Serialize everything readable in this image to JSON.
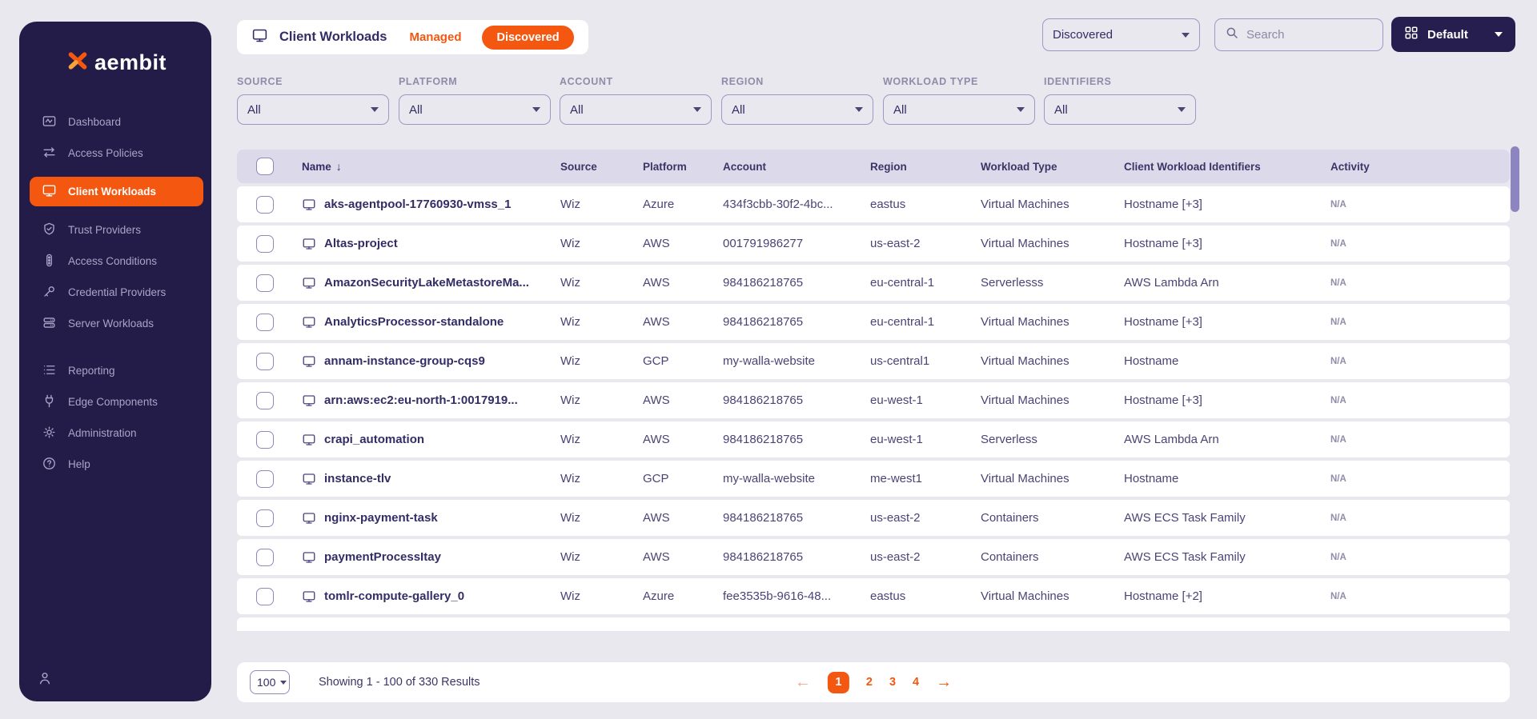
{
  "brand": {
    "logo_text": "aembit"
  },
  "colors": {
    "accent_orange": "#f4570f",
    "sidebar_bg": "#231c48",
    "page_bg": "#e9e8ee",
    "table_header_bg": "#dcdaea"
  },
  "sidebar": {
    "items": [
      {
        "label": "Dashboard",
        "icon": "dashboard-icon",
        "active": false
      },
      {
        "label": "Access Policies",
        "icon": "access-policies-icon",
        "active": false
      },
      {
        "label": "Client Workloads",
        "icon": "client-workloads-icon",
        "active": true
      },
      {
        "label": "Trust Providers",
        "icon": "trust-providers-icon",
        "active": false
      },
      {
        "label": "Access Conditions",
        "icon": "access-conditions-icon",
        "active": false
      },
      {
        "label": "Credential Providers",
        "icon": "credential-providers-icon",
        "active": false
      },
      {
        "label": "Server Workloads",
        "icon": "server-workloads-icon",
        "active": false
      },
      {
        "label": "Reporting",
        "icon": "reporting-icon",
        "active": false
      },
      {
        "label": "Edge Components",
        "icon": "edge-components-icon",
        "active": false
      },
      {
        "label": "Administration",
        "icon": "administration-icon",
        "active": false
      },
      {
        "label": "Help",
        "icon": "help-icon",
        "active": false
      }
    ]
  },
  "header": {
    "title": "Client Workloads",
    "tabs": [
      {
        "label": "Managed",
        "active": false
      },
      {
        "label": "Discovered",
        "active": true
      }
    ]
  },
  "toolbar": {
    "view_dropdown_value": "Discovered",
    "search_placeholder": "Search",
    "layout_button_label": "Default"
  },
  "filters": [
    {
      "label": "SOURCE",
      "value": "All"
    },
    {
      "label": "PLATFORM",
      "value": "All"
    },
    {
      "label": "ACCOUNT",
      "value": "All"
    },
    {
      "label": "REGION",
      "value": "All"
    },
    {
      "label": "WORKLOAD TYPE",
      "value": "All"
    },
    {
      "label": "IDENTIFIERS",
      "value": "All"
    }
  ],
  "table": {
    "columns": [
      "Name",
      "Source",
      "Platform",
      "Account",
      "Region",
      "Workload Type",
      "Client Workload Identifiers",
      "Activity"
    ],
    "sort_column": "Name",
    "sort_direction": "desc",
    "rows": [
      {
        "name": "aks-agentpool-17760930-vmss_1",
        "source": "Wiz",
        "platform": "Azure",
        "account": "434f3cbb-30f2-4bc...",
        "region": "eastus",
        "workload_type": "Virtual Machines",
        "identifiers": "Hostname [+3]",
        "activity": "N/A"
      },
      {
        "name": "Altas-project",
        "source": "Wiz",
        "platform": "AWS",
        "account": "001791986277",
        "region": "us-east-2",
        "workload_type": "Virtual Machines",
        "identifiers": "Hostname [+3]",
        "activity": "N/A"
      },
      {
        "name": "AmazonSecurityLakeMetastoreMa...",
        "source": "Wiz",
        "platform": "AWS",
        "account": "984186218765",
        "region": "eu-central-1",
        "workload_type": "Serverlesss",
        "identifiers": "AWS Lambda Arn",
        "activity": "N/A"
      },
      {
        "name": "AnalyticsProcessor-standalone",
        "source": "Wiz",
        "platform": "AWS",
        "account": "984186218765",
        "region": "eu-central-1",
        "workload_type": "Virtual Machines",
        "identifiers": "Hostname [+3]",
        "activity": "N/A"
      },
      {
        "name": "annam-instance-group-cqs9",
        "source": "Wiz",
        "platform": "GCP",
        "account": "my-walla-website",
        "region": "us-central1",
        "workload_type": "Virtual Machines",
        "identifiers": "Hostname",
        "activity": "N/A"
      },
      {
        "name": "arn:aws:ec2:eu-north-1:0017919...",
        "source": "Wiz",
        "platform": "AWS",
        "account": "984186218765",
        "region": "eu-west-1",
        "workload_type": "Virtual Machines",
        "identifiers": "Hostname [+3]",
        "activity": "N/A"
      },
      {
        "name": "crapi_automation",
        "source": "Wiz",
        "platform": "AWS",
        "account": "984186218765",
        "region": "eu-west-1",
        "workload_type": "Serverless",
        "identifiers": "AWS Lambda Arn",
        "activity": "N/A"
      },
      {
        "name": "instance-tlv",
        "source": "Wiz",
        "platform": "GCP",
        "account": "my-walla-website",
        "region": "me-west1",
        "workload_type": "Virtual Machines",
        "identifiers": "Hostname",
        "activity": "N/A"
      },
      {
        "name": "nginx-payment-task",
        "source": "Wiz",
        "platform": "AWS",
        "account": "984186218765",
        "region": "us-east-2",
        "workload_type": "Containers",
        "identifiers": "AWS ECS Task Family",
        "activity": "N/A"
      },
      {
        "name": "paymentProcessItay",
        "source": "Wiz",
        "platform": "AWS",
        "account": "984186218765",
        "region": "us-east-2",
        "workload_type": "Containers",
        "identifiers": "AWS ECS Task Family",
        "activity": "N/A"
      },
      {
        "name": "tomlr-compute-gallery_0",
        "source": "Wiz",
        "platform": "Azure",
        "account": "fee3535b-9616-48...",
        "region": "eastus",
        "workload_type": "Virtual Machines",
        "identifiers": "Hostname [+2]",
        "activity": "N/A"
      }
    ]
  },
  "footer": {
    "page_size": "100",
    "summary": "Showing 1 - 100 of 330 Results",
    "pages": [
      "1",
      "2",
      "3",
      "4"
    ],
    "active_page": "1"
  }
}
